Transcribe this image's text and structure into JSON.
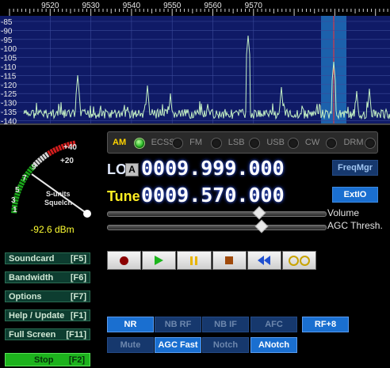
{
  "spectrum": {
    "freq_ticks": [
      "9520",
      "9530",
      "9540",
      "9550",
      "9560",
      "9570"
    ],
    "db_ticks": [
      "-85",
      "-90",
      "-95",
      "-100",
      "-105",
      "-110",
      "-115",
      "-120",
      "-125",
      "-130",
      "-135",
      "-140"
    ],
    "colors": {
      "background": "#0f1a66",
      "trace": "#c4f0c4",
      "passband": "#1f6fb8",
      "cursor": "#ff3030"
    }
  },
  "meter": {
    "scale_top": [
      "+40",
      "+20"
    ],
    "scale_digits": [
      "9",
      "7",
      "5",
      "3",
      "1"
    ],
    "units_line1": "S-units",
    "units_line2": "Squelch",
    "reading": "-92.6 dBm"
  },
  "modes": [
    {
      "label": "AM",
      "active": true
    },
    {
      "label": "ECSS",
      "active": false
    },
    {
      "label": "FM",
      "active": false
    },
    {
      "label": "LSB",
      "active": false
    },
    {
      "label": "USB",
      "active": false
    },
    {
      "label": "CW",
      "active": false
    },
    {
      "label": "DRM",
      "active": false
    }
  ],
  "lo": {
    "label": "LO",
    "badge": "A",
    "value": "0009.999.000"
  },
  "tune": {
    "label": "Tune",
    "value": "0009.570.000"
  },
  "buttons": {
    "freqmgr": "FreqMgr",
    "extio": "ExtIO"
  },
  "sliders": {
    "volume": {
      "label": "Volume",
      "level": 0.69
    },
    "agc": {
      "label": "AGC Thresh.",
      "level": 0.7
    }
  },
  "transport": [
    "record",
    "play",
    "pause",
    "stop",
    "rewind",
    "loop"
  ],
  "left_buttons": [
    {
      "label": "Soundcard",
      "key": "[F5]"
    },
    {
      "label": "Bandwidth",
      "key": "[F6]"
    },
    {
      "label": "Options",
      "key": "[F7]"
    },
    {
      "label": "Help / Update",
      "key": "[F1]"
    },
    {
      "label": "Full Screen",
      "key": "[F11]"
    },
    {
      "label": "Stop",
      "key": "[F2]"
    }
  ],
  "processing": {
    "nr": "NR",
    "nb_rf": "NB RF",
    "nb_if": "NB IF",
    "afc": "AFC",
    "rf8": "RF+8",
    "mute": "Mute",
    "agc_fast": "AGC Fast",
    "notch": "Notch",
    "anotch": "ANotch"
  }
}
